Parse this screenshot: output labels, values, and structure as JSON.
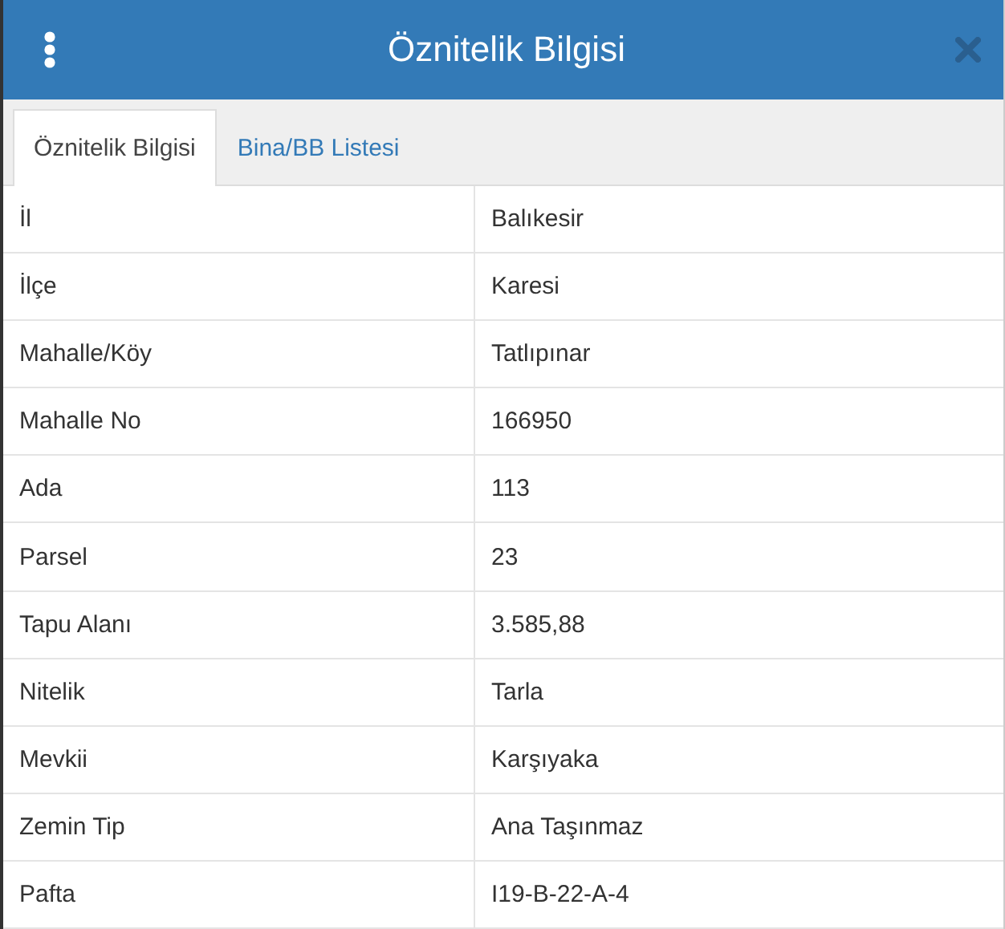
{
  "window": {
    "title": "Öznitelik Bilgisi"
  },
  "tabs": [
    {
      "label": "Öznitelik Bilgisi",
      "selected": true
    },
    {
      "label": "Bina/BB Listesi",
      "selected": false
    }
  ],
  "table": {
    "rows": [
      {
        "label": "İl",
        "value": "Balıkesir"
      },
      {
        "label": "İlçe",
        "value": "Karesi"
      },
      {
        "label": "Mahalle/Köy",
        "value": "Tatlıpınar"
      },
      {
        "label": "Mahalle No",
        "value": "166950"
      },
      {
        "label": "Ada",
        "value": "113"
      },
      {
        "label": "Parsel",
        "value": "23"
      },
      {
        "label": "Tapu Alanı",
        "value": "3.585,88"
      },
      {
        "label": "Nitelik",
        "value": "Tarla"
      },
      {
        "label": "Mevkii",
        "value": "Karşıyaka"
      },
      {
        "label": "Zemin Tip",
        "value": "Ana Taşınmaz"
      },
      {
        "label": "Pafta",
        "value": "I19-B-22-A-4"
      }
    ]
  }
}
